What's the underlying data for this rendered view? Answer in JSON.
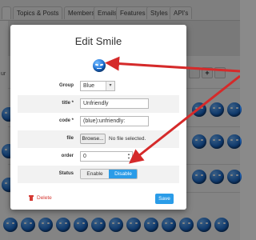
{
  "nav": {
    "tabs": [
      "",
      "Topics & Posts",
      "Members",
      "Emails",
      "Features",
      "Styles",
      "API's"
    ]
  },
  "background": {
    "side_fragment": "ur",
    "plus_label": "+"
  },
  "modal": {
    "title": "Edit Smile",
    "fields": {
      "group_label": "Group",
      "group_value": "Blue",
      "title_label": "title *",
      "title_value": "Unfriendly",
      "code_label": "code *",
      "code_value": "(blue):unfriendly:",
      "file_label": "file",
      "browse_label": "Browse...",
      "no_file_text": "No file selected.",
      "order_label": "order",
      "order_value": "0",
      "status_label": "Status",
      "enable_label": "Enable",
      "disable_label": "Disable"
    },
    "delete_label": "Delete",
    "save_label": "Save"
  },
  "colors": {
    "accent": "#2a9ce8",
    "danger": "#d63a34",
    "annotation_arrow": "#d52a2a"
  },
  "icons": {
    "preview": "blue-unfriendly-smiley-icon",
    "delete": "trash-icon"
  }
}
